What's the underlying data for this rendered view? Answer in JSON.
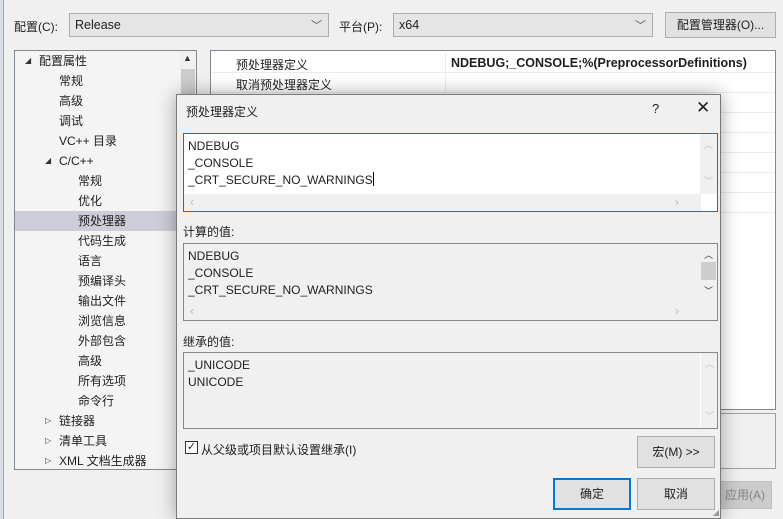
{
  "toolbar": {
    "config_label": "配置(C):",
    "config_value": "Release",
    "platform_label": "平台(P):",
    "platform_value": "x64",
    "config_manager_label": "配置管理器(O)..."
  },
  "tree": {
    "items": [
      {
        "label": "配置属性",
        "level": 0,
        "expander": "expanded"
      },
      {
        "label": "常规",
        "level": 1
      },
      {
        "label": "高级",
        "level": 1
      },
      {
        "label": "调试",
        "level": 1
      },
      {
        "label": "VC++ 目录",
        "level": 1
      },
      {
        "label": "C/C++",
        "level": 1,
        "expander": "expanded"
      },
      {
        "label": "常规",
        "level": 2
      },
      {
        "label": "优化",
        "level": 2
      },
      {
        "label": "预处理器",
        "level": 2,
        "selected": true
      },
      {
        "label": "代码生成",
        "level": 2
      },
      {
        "label": "语言",
        "level": 2
      },
      {
        "label": "预编译头",
        "level": 2
      },
      {
        "label": "输出文件",
        "level": 2
      },
      {
        "label": "浏览信息",
        "level": 2
      },
      {
        "label": "外部包含",
        "level": 2
      },
      {
        "label": "高级",
        "level": 2
      },
      {
        "label": "所有选项",
        "level": 2
      },
      {
        "label": "命令行",
        "level": 2
      },
      {
        "label": "链接器",
        "level": 1,
        "expander": "collapsed"
      },
      {
        "label": "清单工具",
        "level": 1,
        "expander": "collapsed"
      },
      {
        "label": "XML 文档生成器",
        "level": 1,
        "expander": "collapsed"
      }
    ]
  },
  "grid": {
    "rows": [
      {
        "name": "预处理器定义",
        "value": "NDEBUG;_CONSOLE;%(PreprocessorDefinitions)"
      },
      {
        "name": "取消预处理器定义",
        "value": ""
      }
    ]
  },
  "apply_label": "应用(A)",
  "dialog": {
    "title": "预处理器定义",
    "help": "?",
    "close": "✕",
    "edit_lines": [
      "NDEBUG",
      "_CONSOLE",
      "_CRT_SECURE_NO_WARNINGS"
    ],
    "computed_label": "计算的值:",
    "computed_lines": [
      "NDEBUG",
      "_CONSOLE",
      "_CRT_SECURE_NO_WARNINGS"
    ],
    "inherited_label": "继承的值:",
    "inherited_lines": [
      "_UNICODE",
      "UNICODE"
    ],
    "inherit_checkbox_label": "从父级或项目默认设置继承(I)",
    "inherit_checked": true,
    "macro_button": "宏(M) >>",
    "ok_button": "确定",
    "cancel_button": "取消"
  },
  "colors": {
    "accent": "#0078d7",
    "selection": "#cdcdd9"
  }
}
